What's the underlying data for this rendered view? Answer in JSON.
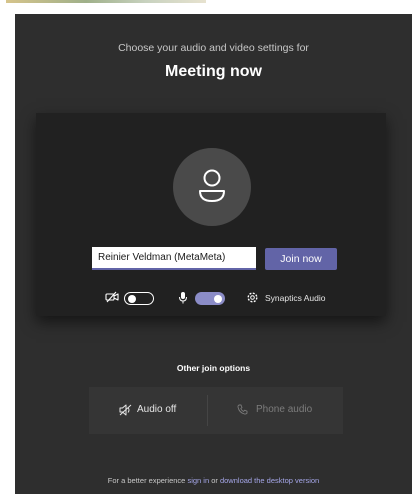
{
  "header": {
    "subtitle": "Choose your audio and video settings for",
    "title": "Meeting now"
  },
  "preview": {
    "name_value": "Reinier Veldman (MetaMeta)",
    "join_label": "Join now",
    "camera_on": false,
    "mic_on": true,
    "audio_device": "Synaptics Audio"
  },
  "other_options": {
    "heading": "Other join options",
    "audio_off_label": "Audio off",
    "phone_audio_label": "Phone audio"
  },
  "footer": {
    "prefix": "For a better experience ",
    "sign_in": "sign in",
    "middle": " or ",
    "download": "download the desktop version"
  },
  "colors": {
    "accent": "#6264a7",
    "toggle_on": "#8b8cc7",
    "panel_bg": "#2e2e2e",
    "preview_bg": "#212121",
    "link": "#a5a6e8"
  },
  "icons": {
    "avatar": "person-icon",
    "camera": "camera-off-icon",
    "mic": "microphone-icon",
    "device": "gear-icon",
    "audio_off": "speaker-off-icon",
    "phone": "phone-icon"
  }
}
